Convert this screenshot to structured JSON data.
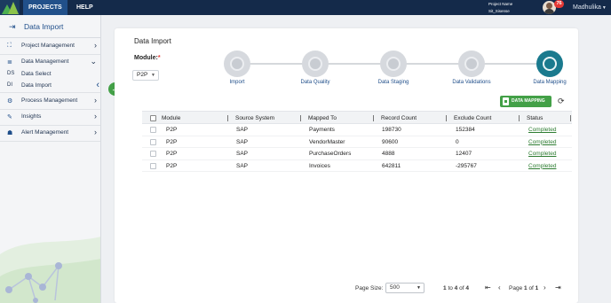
{
  "topbar": {
    "nav": [
      "PROJECTS",
      "HELP"
    ],
    "project_name_label": "Project Name",
    "project_name_value": "Sit_Sisense",
    "notification_count": "76",
    "username": "Madhulika"
  },
  "sidebar": {
    "title": "Data Import",
    "items": [
      {
        "label": "Project Management"
      },
      {
        "label": "Data Management"
      },
      {
        "label": "Process Management"
      },
      {
        "label": "Insights"
      },
      {
        "label": "Alert Management"
      }
    ],
    "sub_items": [
      {
        "abbr": "DS",
        "label": "Data Select"
      },
      {
        "abbr": "DI",
        "label": "Data Import"
      }
    ]
  },
  "main": {
    "title": "Data Import",
    "module_label": "Module:",
    "module_required": "*",
    "module_value": "P2P",
    "steps": [
      "Import",
      "Data Quality",
      "Data Staging",
      "Data Validations",
      "Data Mapping"
    ],
    "active_step": "Data Mapping",
    "data_mapping_button": "DATA MAPPING"
  },
  "table": {
    "columns": [
      "Module",
      "Source System",
      "Mapped To",
      "Record Count",
      "Exclude Count",
      "Status"
    ],
    "rows": [
      [
        "P2P",
        "SAP",
        "Payments",
        "198730",
        "152384",
        "Completed"
      ],
      [
        "P2P",
        "SAP",
        "VendorMaster",
        "90600",
        "0",
        "Completed"
      ],
      [
        "P2P",
        "SAP",
        "PurchaseOrders",
        "4888",
        "12407",
        "Completed"
      ],
      [
        "P2P",
        "SAP",
        "Invoices",
        "642811",
        "-295767",
        "Completed"
      ]
    ]
  },
  "pager": {
    "page_size_label": "Page Size:",
    "page_size": "500",
    "range_from": "1",
    "range_to_word": "to",
    "range_to": "4",
    "of_word": "of",
    "total": "4",
    "page_word": "Page",
    "page": "1",
    "page_of_word": "of",
    "page_total": "1"
  },
  "colors": {
    "topbar": "#142a4a",
    "accent_green": "#43a047",
    "active_step": "#1a7a8e",
    "status_link": "#2e7d32"
  }
}
